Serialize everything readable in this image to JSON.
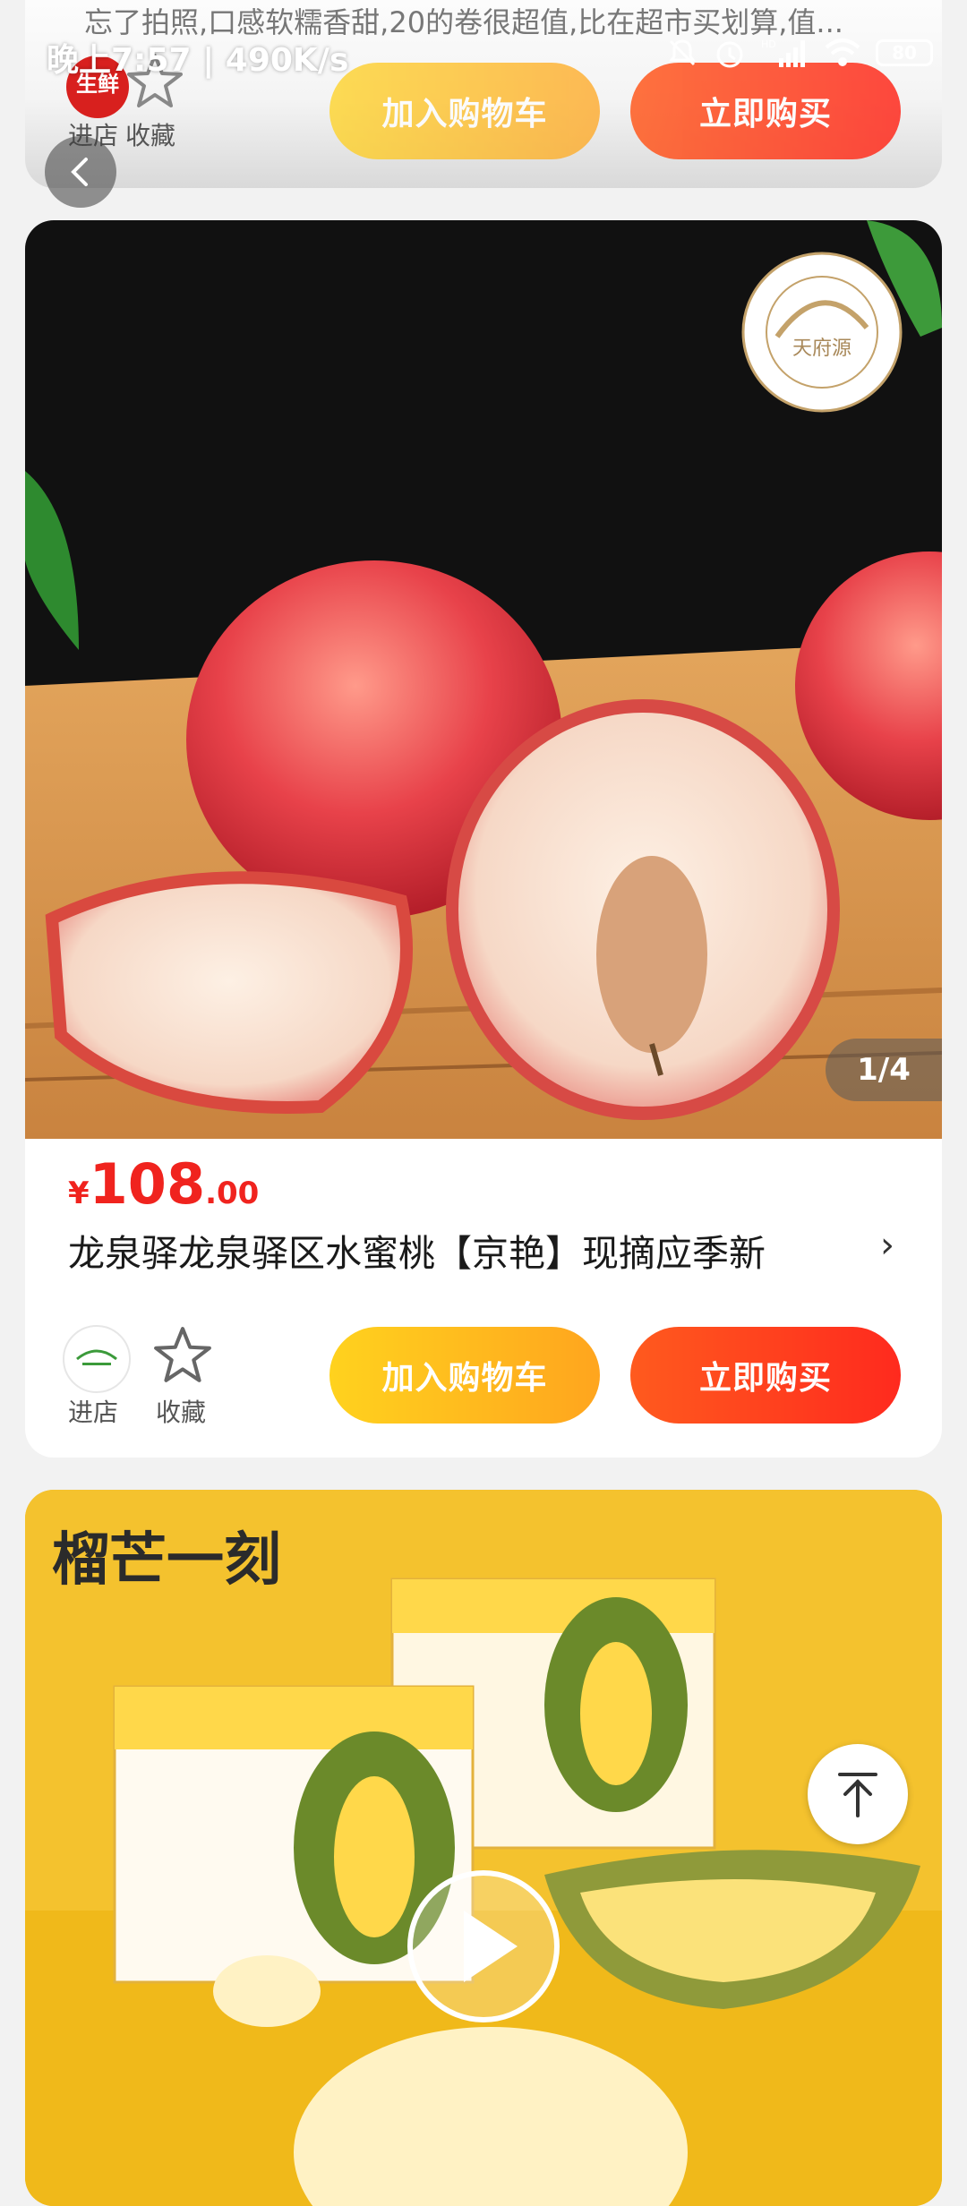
{
  "status_bar": {
    "time": "晚上7:57",
    "network_speed": "490K/s",
    "battery": "80"
  },
  "top_card": {
    "review_text": "忘了拍照,口感软糯香甜,20的卷很超值,比在超市买划算,值...",
    "shop_badge": "生鲜",
    "shop_label": "进店",
    "fav_label": "收藏",
    "cart_label": "加入购物车",
    "buy_label": "立即购买"
  },
  "product": {
    "image_page": "1/4",
    "currency": "¥",
    "price_int": "108",
    "price_dec": ".00",
    "title": "龙泉驿龙泉驿区水蜜桃【京艳】现摘应季新",
    "seal_text": "天府源",
    "shop_label": "进店",
    "fav_label": "收藏",
    "cart_label": "加入购物车",
    "buy_label": "立即购买"
  },
  "next_product": {
    "brand_text": "榴芒一刻"
  },
  "colors": {
    "accent_red": "#f0231e",
    "cart_yellow": "#ffb81e",
    "buy_red": "#ff3c1e"
  }
}
